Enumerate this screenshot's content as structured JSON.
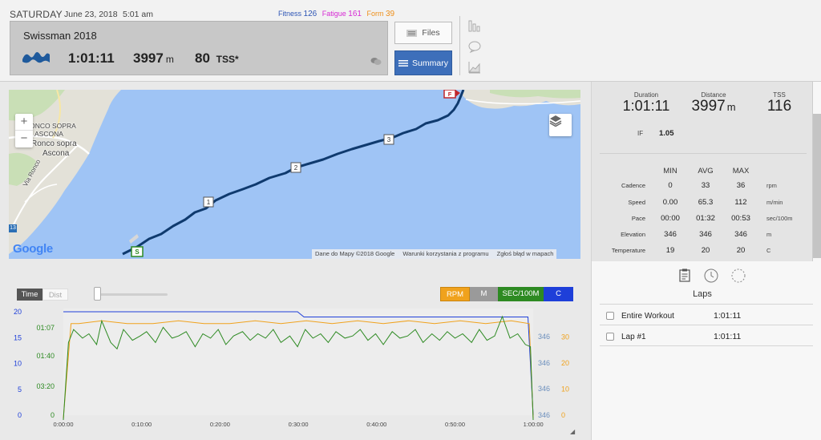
{
  "header": {
    "day": "SATURDAY",
    "date": "June 23, 2018",
    "time": "5:01 am",
    "metrics": {
      "fitness_label": "Fitness",
      "fitness_value": "126",
      "fatigue_label": "Fatigue",
      "fatigue_value": "161",
      "form_label": "Form",
      "form_value": "39"
    }
  },
  "workout": {
    "name": "Swissman 2018",
    "sport_icon": "swim-wave-icon",
    "duration": "1:01:11",
    "distance": "3997",
    "distance_unit": "m",
    "tss": "80",
    "tss_unit": "TSS*"
  },
  "buttons": {
    "files": "Files",
    "summary": "Summary"
  },
  "side_icons": [
    "bar-chart-icon",
    "comment-icon",
    "trend-chart-icon"
  ],
  "map": {
    "labels": {
      "ronco1": "RONCO SOPRA",
      "ronco2": "ASCONA",
      "ronco3": "Ronco sopra",
      "ronco4": "Ascona",
      "via": "Via Ronco"
    },
    "route_shield": "13",
    "markers": {
      "start": "S",
      "finish": "F",
      "km1": "1",
      "km2": "2",
      "km3": "3"
    },
    "zoom_in": "+",
    "zoom_out": "−",
    "google": "Google",
    "attribution": [
      "Dane do Mapy ©2018 Google",
      "Warunki korzystania z programu",
      "Zgłoś błąd w mapach"
    ]
  },
  "chart_controls": {
    "time": "Time",
    "dist": "Dist",
    "channels": {
      "rpm": "RPM",
      "m": "M",
      "sec": "SEC/100M",
      "c": "C"
    },
    "colors": {
      "rpm": "#f0a21d",
      "m": "#9a9a9a",
      "sec": "#2d8a22",
      "c": "#1e3fd9"
    }
  },
  "chart_data": {
    "type": "line",
    "x_ticks": [
      "0:00:00",
      "0:10:00",
      "0:20:00",
      "0:30:00",
      "0:40:00",
      "0:50:00",
      "1:00:00"
    ],
    "x_range_seconds": [
      0,
      3671
    ],
    "axes": {
      "celsius": {
        "ticks": [
          "0",
          "5",
          "10",
          "15",
          "20"
        ],
        "range": [
          0,
          20
        ],
        "color": "#1e3fd9"
      },
      "pace": {
        "ticks": [
          "03:20",
          "01:40",
          "01:07"
        ],
        "color": "#2d8a22"
      },
      "elevation": {
        "ticks": [
          "346",
          "346",
          "346",
          "346"
        ],
        "color": "#6c8fbd"
      },
      "rpm": {
        "ticks": [
          "0",
          "10",
          "20",
          "30"
        ],
        "range": [
          0,
          36
        ],
        "color": "#f0a21d"
      }
    },
    "series": [
      {
        "name": "C",
        "color": "#1e3fd9",
        "x": [
          0,
          1830,
          1880,
          3630,
          3671
        ],
        "y": [
          20,
          20,
          19,
          19,
          0
        ]
      },
      {
        "name": "RPM",
        "color": "#f0a21d",
        "x": [
          0,
          60,
          120,
          300,
          500,
          700,
          900,
          1100,
          1300,
          1500,
          1700,
          1900,
          2100,
          2300,
          2500,
          2700,
          2900,
          3100,
          3300,
          3500,
          3640,
          3671
        ],
        "y": [
          0,
          33,
          33,
          34,
          33,
          33,
          34,
          33,
          33,
          34,
          33,
          34,
          33,
          34,
          33,
          34,
          33,
          34,
          33,
          34,
          33,
          0
        ]
      },
      {
        "name": "SEC/100M",
        "color": "#2d8a22",
        "x": [
          0,
          40,
          80,
          150,
          200,
          260,
          300,
          370,
          420,
          470,
          540,
          600,
          650,
          720,
          780,
          850,
          900,
          960,
          1030,
          1090,
          1150,
          1210,
          1270,
          1330,
          1400,
          1460,
          1520,
          1580,
          1640,
          1700,
          1770,
          1830,
          1890,
          1950,
          2010,
          2070,
          2130,
          2200,
          2260,
          2320,
          2380,
          2440,
          2500,
          2570,
          2630,
          2690,
          2750,
          2810,
          2880,
          2940,
          3000,
          3060,
          3120,
          3190,
          3250,
          3310,
          3370,
          3430,
          3490,
          3550,
          3610,
          3650,
          3671
        ],
        "y": [
          3.4,
          1.6,
          1.3,
          1.5,
          1.4,
          1.65,
          1.1,
          1.6,
          1.75,
          1.3,
          1.55,
          1.45,
          1.35,
          1.6,
          1.25,
          1.5,
          1.45,
          1.35,
          1.7,
          1.4,
          1.5,
          1.3,
          1.65,
          1.45,
          1.35,
          1.55,
          1.4,
          1.5,
          1.3,
          1.6,
          1.45,
          1.7,
          1.3,
          1.5,
          1.4,
          1.6,
          1.35,
          1.5,
          1.45,
          1.3,
          1.55,
          1.4,
          1.65,
          1.35,
          1.5,
          1.45,
          1.3,
          1.6,
          1.4,
          1.55,
          1.35,
          1.5,
          1.4,
          1.6,
          1.3,
          1.55,
          1.45,
          1.0,
          1.5,
          1.4,
          1.65,
          1.7,
          3.4
        ]
      }
    ],
    "grid": false
  },
  "stats": {
    "duration_label": "Duration",
    "duration_value": "1:01:11",
    "distance_label": "Distance",
    "distance_value": "3997",
    "distance_unit": "m",
    "tss_label": "TSS",
    "tss_value": "116",
    "if_label": "IF",
    "if_value": "1.05",
    "columns": [
      "MIN",
      "AVG",
      "MAX"
    ],
    "rows": [
      {
        "label": "Cadence",
        "min": "0",
        "avg": "33",
        "max": "36",
        "unit": "rpm"
      },
      {
        "label": "Speed",
        "min": "0.00",
        "avg": "65.3",
        "max": "112",
        "unit": "m/min"
      },
      {
        "label": "Pace",
        "min": "00:00",
        "avg": "01:32",
        "max": "00:53",
        "unit": "sec/100m"
      },
      {
        "label": "Elevation",
        "min": "346",
        "avg": "346",
        "max": "346",
        "unit": "m"
      },
      {
        "label": "Temperature",
        "min": "19",
        "avg": "20",
        "max": "20",
        "unit": "C"
      }
    ]
  },
  "laps": {
    "title": "Laps",
    "items": [
      {
        "name": "Entire Workout",
        "time": "1:01:11"
      },
      {
        "name": "Lap #1",
        "time": "1:01:11"
      }
    ]
  }
}
